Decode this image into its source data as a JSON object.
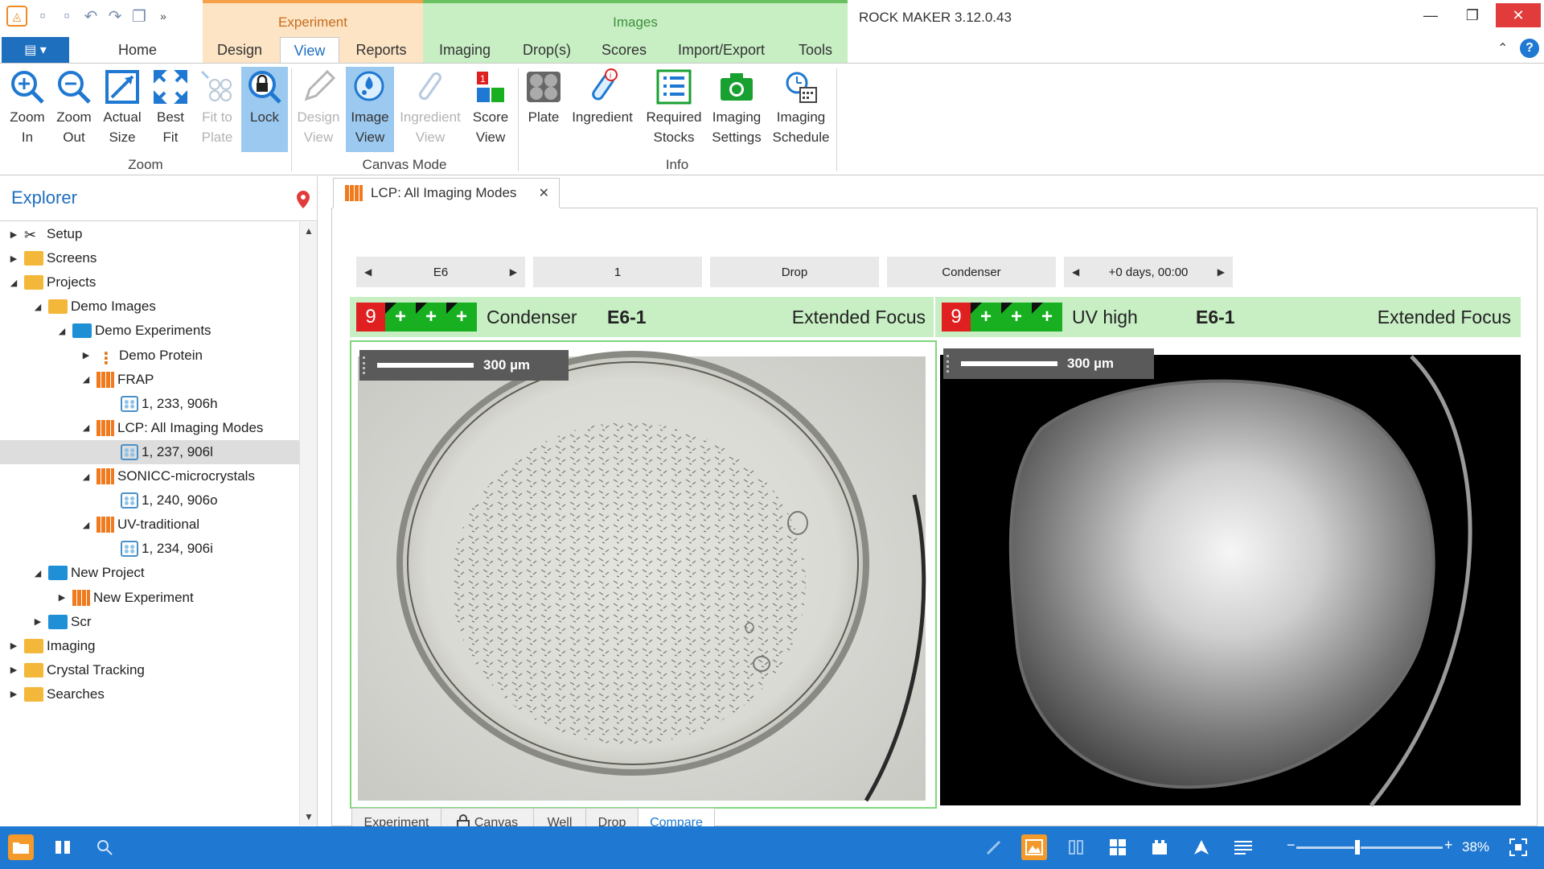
{
  "app": {
    "title": "ROCK MAKER 3.12.0.43"
  },
  "ribbon": {
    "context_experiment": "Experiment",
    "context_images": "Images",
    "tabs": [
      {
        "label": "Home"
      },
      {
        "label": "Design"
      },
      {
        "label": "View"
      },
      {
        "label": "Reports"
      },
      {
        "label": "Imaging"
      },
      {
        "label": "Drop(s)"
      },
      {
        "label": "Scores"
      },
      {
        "label": "Import/Export"
      },
      {
        "label": "Tools"
      }
    ],
    "active_tab": "View",
    "buttons": {
      "zoom_in": [
        "Zoom",
        "In"
      ],
      "zoom_out": [
        "Zoom",
        "Out"
      ],
      "actual_size": [
        "Actual",
        "Size"
      ],
      "best_fit": [
        "Best",
        "Fit"
      ],
      "fit_to_plate": [
        "Fit to",
        "Plate"
      ],
      "lock": [
        "Lock"
      ],
      "design_view": [
        "Design",
        "View"
      ],
      "image_view": [
        "Image",
        "View"
      ],
      "ingredient_view": [
        "Ingredient",
        "View"
      ],
      "score_view": [
        "Score",
        "View"
      ],
      "plate": [
        "Plate"
      ],
      "ingredient": [
        "Ingredient"
      ],
      "required_stocks": [
        "Required",
        "Stocks"
      ],
      "imaging_settings": [
        "Imaging",
        "Settings"
      ],
      "imaging_schedule": [
        "Imaging",
        "Schedule"
      ]
    },
    "groups": {
      "zoom": "Zoom",
      "canvas_mode": "Canvas Mode",
      "info": "Info"
    }
  },
  "explorer": {
    "title": "Explorer",
    "nodes": [
      {
        "label": "Setup",
        "level": 0,
        "icon": "tools-icon",
        "expand": "collapsed"
      },
      {
        "label": "Screens",
        "level": 0,
        "icon": "folder-yellow",
        "expand": "collapsed"
      },
      {
        "label": "Projects",
        "level": 0,
        "icon": "folder-yellow",
        "expand": "expanded"
      },
      {
        "label": "Demo Images",
        "level": 1,
        "icon": "folder-yellow",
        "expand": "expanded"
      },
      {
        "label": "Demo Experiments",
        "level": 2,
        "icon": "folder-blue",
        "expand": "expanded"
      },
      {
        "label": "Demo Protein",
        "level": 3,
        "icon": "protein-icon",
        "expand": "collapsed"
      },
      {
        "label": "FRAP",
        "level": 3,
        "icon": "grid-icon",
        "expand": "expanded"
      },
      {
        "label": "1, 233, 906h",
        "level": 4,
        "icon": "plate-icon",
        "expand": "none"
      },
      {
        "label": "LCP: All Imaging Modes",
        "level": 3,
        "icon": "grid-icon",
        "expand": "expanded"
      },
      {
        "label": "1, 237, 906l",
        "level": 4,
        "icon": "plate-icon",
        "expand": "none",
        "selected": true
      },
      {
        "label": "SONICC-microcrystals",
        "level": 3,
        "icon": "grid-icon",
        "expand": "expanded"
      },
      {
        "label": "1, 240, 906o",
        "level": 4,
        "icon": "plate-icon",
        "expand": "none"
      },
      {
        "label": "UV-traditional",
        "level": 3,
        "icon": "grid-icon",
        "expand": "expanded"
      },
      {
        "label": "1, 234, 906i",
        "level": 4,
        "icon": "plate-icon",
        "expand": "none"
      },
      {
        "label": "New Project",
        "level": 1,
        "icon": "folder-blue",
        "expand": "expanded"
      },
      {
        "label": "New Experiment",
        "level": 2,
        "icon": "grid-icon",
        "expand": "collapsed"
      },
      {
        "label": "Scr",
        "level": 1,
        "icon": "folder-blue",
        "expand": "collapsed"
      },
      {
        "label": "Imaging",
        "level": 0,
        "icon": "folder-yellow",
        "expand": "collapsed"
      },
      {
        "label": "Crystal Tracking",
        "level": 0,
        "icon": "folder-yellow",
        "expand": "collapsed"
      },
      {
        "label": "Searches",
        "level": 0,
        "icon": "folder-yellow",
        "expand": "collapsed"
      }
    ]
  },
  "document": {
    "tab_title": "LCP: All Imaging Modes",
    "nav": {
      "well": "E6",
      "drop_number": "1",
      "drop_label": "Drop",
      "imaging_mode": "Condenser",
      "time": "+0 days, 00:00"
    },
    "left_image": {
      "score": "9",
      "plus_marks": [
        "+",
        "+",
        "+"
      ],
      "mode": "Condenser",
      "drop_id": "E6-1",
      "type": "Extended Focus",
      "scale": "300 µm"
    },
    "right_image": {
      "score": "9",
      "plus_marks": [
        "+",
        "+",
        "+"
      ],
      "mode": "UV high",
      "drop_id": "E6-1",
      "type": "Extended Focus",
      "scale": "300 µm"
    },
    "view_tabs": [
      {
        "label": "Experiment"
      },
      {
        "label": "Canvas"
      },
      {
        "label": "Well"
      },
      {
        "label": "Drop"
      },
      {
        "label": "Compare"
      }
    ],
    "active_view_tab": "Compare"
  },
  "status": {
    "zoom_level": "38%",
    "zoom_fraction": 0.38
  },
  "colors": {
    "accent": "#1f78d1",
    "context_experiment": "#fde4c4",
    "context_images": "#c8efc4",
    "score_red": "#e02020",
    "score_green": "#18b020"
  }
}
